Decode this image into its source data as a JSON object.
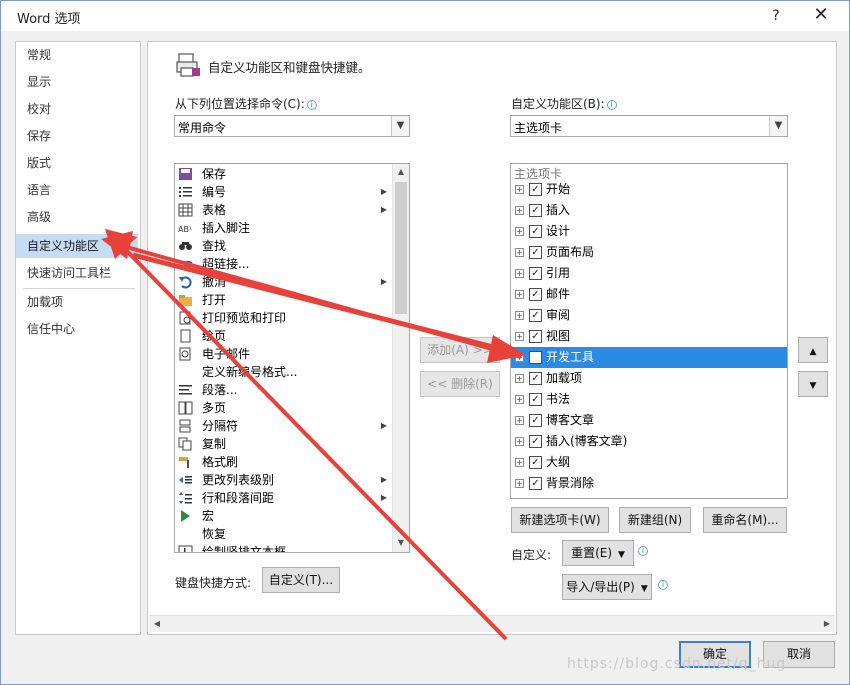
{
  "window": {
    "title": "Word 选项",
    "help": "?",
    "close": "✕"
  },
  "nav": {
    "items": [
      "常规",
      "显示",
      "校对",
      "保存",
      "版式",
      "语言",
      "高级",
      "自定义功能区",
      "快速访问工具栏",
      "加载项",
      "信任中心"
    ],
    "active_index": 7
  },
  "header": {
    "text": "自定义功能区和键盘快捷键。"
  },
  "left_panel": {
    "label": "从下列位置选择命令(C):",
    "combo_value": "常用命令",
    "commands": [
      {
        "label": "保存",
        "icon": "save-icon",
        "submenu": false
      },
      {
        "label": "编号",
        "icon": "numbering-icon",
        "submenu": true
      },
      {
        "label": "表格",
        "icon": "table-icon",
        "submenu": true
      },
      {
        "label": "插入脚注",
        "icon": "footnote-icon",
        "submenu": false
      },
      {
        "label": "查找",
        "icon": "find-icon",
        "submenu": false
      },
      {
        "label": "超链接...",
        "icon": "hyperlink-icon",
        "submenu": false
      },
      {
        "label": "撤消",
        "icon": "undo-icon",
        "submenu": true
      },
      {
        "label": "打开",
        "icon": "folder-icon",
        "submenu": false
      },
      {
        "label": "打印预览和打印",
        "icon": "print-preview-icon",
        "submenu": false
      },
      {
        "label": "绘页",
        "icon": "page-icon",
        "submenu": false
      },
      {
        "label": "电子邮件",
        "icon": "email-icon",
        "submenu": false
      },
      {
        "label": "定义新编号格式...",
        "icon": "",
        "submenu": false
      },
      {
        "label": "段落...",
        "icon": "paragraph-icon",
        "submenu": false
      },
      {
        "label": "多页",
        "icon": "multipage-icon",
        "submenu": false
      },
      {
        "label": "分隔符",
        "icon": "separator-icon",
        "submenu": true
      },
      {
        "label": "复制",
        "icon": "copy-icon",
        "submenu": false
      },
      {
        "label": "格式刷",
        "icon": "format-painter-icon",
        "submenu": false
      },
      {
        "label": "更改列表级别",
        "icon": "list-level-icon",
        "submenu": true
      },
      {
        "label": "行和段落间距",
        "icon": "line-spacing-icon",
        "submenu": true
      },
      {
        "label": "宏",
        "icon": "macro-icon",
        "submenu": false
      },
      {
        "label": "恢复",
        "icon": "",
        "submenu": false
      },
      {
        "label": "绘制竖排文本框",
        "icon": "textbox-icon",
        "submenu": false
      }
    ]
  },
  "middle": {
    "add": "添加(A) >>",
    "remove": "<< 删除(R)"
  },
  "right_panel": {
    "label": "自定义功能区(B):",
    "combo_value": "主选项卡",
    "group_header": "主选项卡",
    "tabs": [
      {
        "label": "开始",
        "checked": true,
        "selected": false
      },
      {
        "label": "插入",
        "checked": true,
        "selected": false
      },
      {
        "label": "设计",
        "checked": true,
        "selected": false
      },
      {
        "label": "页面布局",
        "checked": true,
        "selected": false
      },
      {
        "label": "引用",
        "checked": true,
        "selected": false
      },
      {
        "label": "邮件",
        "checked": true,
        "selected": false
      },
      {
        "label": "审阅",
        "checked": true,
        "selected": false
      },
      {
        "label": "视图",
        "checked": true,
        "selected": false
      },
      {
        "label": "开发工具",
        "checked": false,
        "selected": true
      },
      {
        "label": "加载项",
        "checked": true,
        "selected": false
      },
      {
        "label": "书法",
        "checked": true,
        "selected": false
      },
      {
        "label": "博客文章",
        "checked": true,
        "selected": false
      },
      {
        "label": "插入(博客文章)",
        "checked": true,
        "selected": false
      },
      {
        "label": "大纲",
        "checked": true,
        "selected": false
      },
      {
        "label": "背景消除",
        "checked": true,
        "selected": false
      }
    ],
    "buttons": {
      "new_tab": "新建选项卡(W)",
      "new_group": "新建组(N)",
      "rename": "重命名(M)..."
    },
    "customize_label": "自定义:",
    "reset": "重置(E)",
    "import_export": "导入/导出(P)"
  },
  "keyboard": {
    "label": "键盘快捷方式:",
    "button": "自定义(T)..."
  },
  "footer": {
    "ok": "确定",
    "cancel": "取消"
  },
  "watermark": "https://blog.csdn.net/q_hug",
  "colors": {
    "selection": "#2b8ae2",
    "nav_active": "#c5dcf2",
    "arrow": "#e8413a"
  }
}
